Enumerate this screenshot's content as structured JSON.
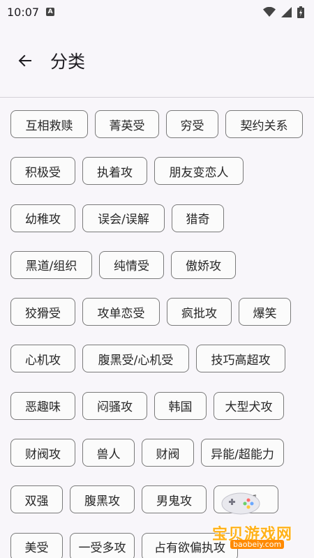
{
  "status_bar": {
    "time": "10:07",
    "notification_icon": "a-badge-icon",
    "badge_letter": "A"
  },
  "header": {
    "title": "分类",
    "back_icon": "arrow-left-icon"
  },
  "chips": [
    "互相救赎",
    "菁英受",
    "穷受",
    "契约关系",
    "积极受",
    "执着攻",
    "朋友变恋人",
    "幼稚攻",
    "误会/误解",
    "猎奇",
    "黑道/组织",
    "纯情受",
    "傲娇攻",
    "狡猾受",
    "攻单恋受",
    "疯批攻",
    "爆笑",
    "心机攻",
    "腹黑受/心机受",
    "技巧高超攻",
    "恶趣味",
    "闷骚攻",
    "韩国",
    "大型犬攻",
    "财阀攻",
    "兽人",
    "财阀",
    "异能/超能力",
    "双强",
    "腹黑攻",
    "男鬼攻",
    "傻受",
    "美受",
    "一受多攻",
    "占有欲偏执攻"
  ],
  "watermark": {
    "title": "宝贝游戏网",
    "url": "baobeiy.com"
  },
  "colors": {
    "background": "#f8f6fa",
    "chip_border": "#7a7a7a",
    "watermark_accent": "#ffb21a"
  }
}
